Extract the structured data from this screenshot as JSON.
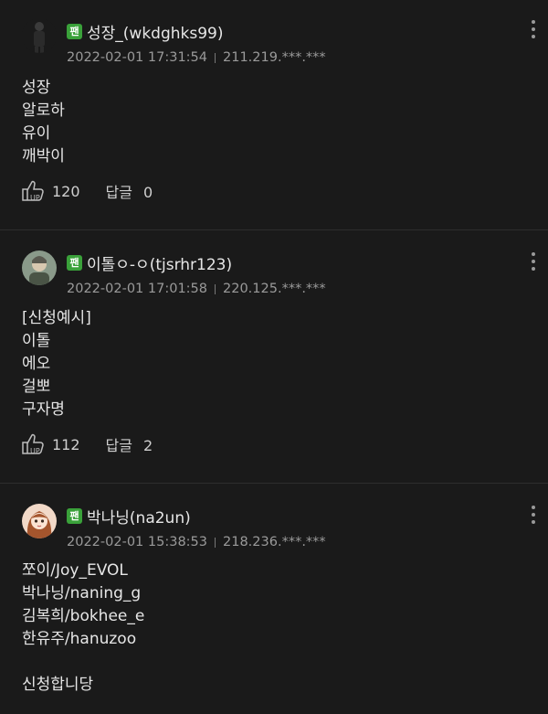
{
  "comments": [
    {
      "badge": "팬",
      "author": "성장_(wkdghks99)",
      "date": "2022-02-01 17:31:54",
      "ip": "211.219.***.***",
      "lines": [
        "성장",
        "알로하",
        "유이",
        "깨박이"
      ],
      "up_label": "UP",
      "up_count": "120",
      "reply_label": "답글",
      "reply_count": "0",
      "avatar_icon": "person-silhouette-avatar"
    },
    {
      "badge": "팬",
      "author": "이톨ㅇ-ㅇ(tjsrhr123)",
      "date": "2022-02-01 17:01:58",
      "ip": "220.125.***.***",
      "lines": [
        "[신청예시]",
        "이톨",
        "에오",
        "걸뽀",
        "구자명"
      ],
      "up_label": "UP",
      "up_count": "112",
      "reply_label": "답글",
      "reply_count": "2",
      "avatar_icon": "photo-avatar"
    },
    {
      "badge": "팬",
      "author": "박나닝(na2un)",
      "date": "2022-02-01 15:38:53",
      "ip": "218.236.***.***",
      "lines": [
        "쪼이/Joy_EVOL",
        "박나닝/naning_g",
        "김복희/bokhee_e",
        "한유주/hanuzoo",
        "",
        "신청합니당"
      ],
      "avatar_icon": "cartoon-girl-avatar"
    }
  ],
  "colors": {
    "background": "#1a1a1a",
    "fan_badge": "#3aa13a",
    "meta_text": "#9a9a9a"
  }
}
